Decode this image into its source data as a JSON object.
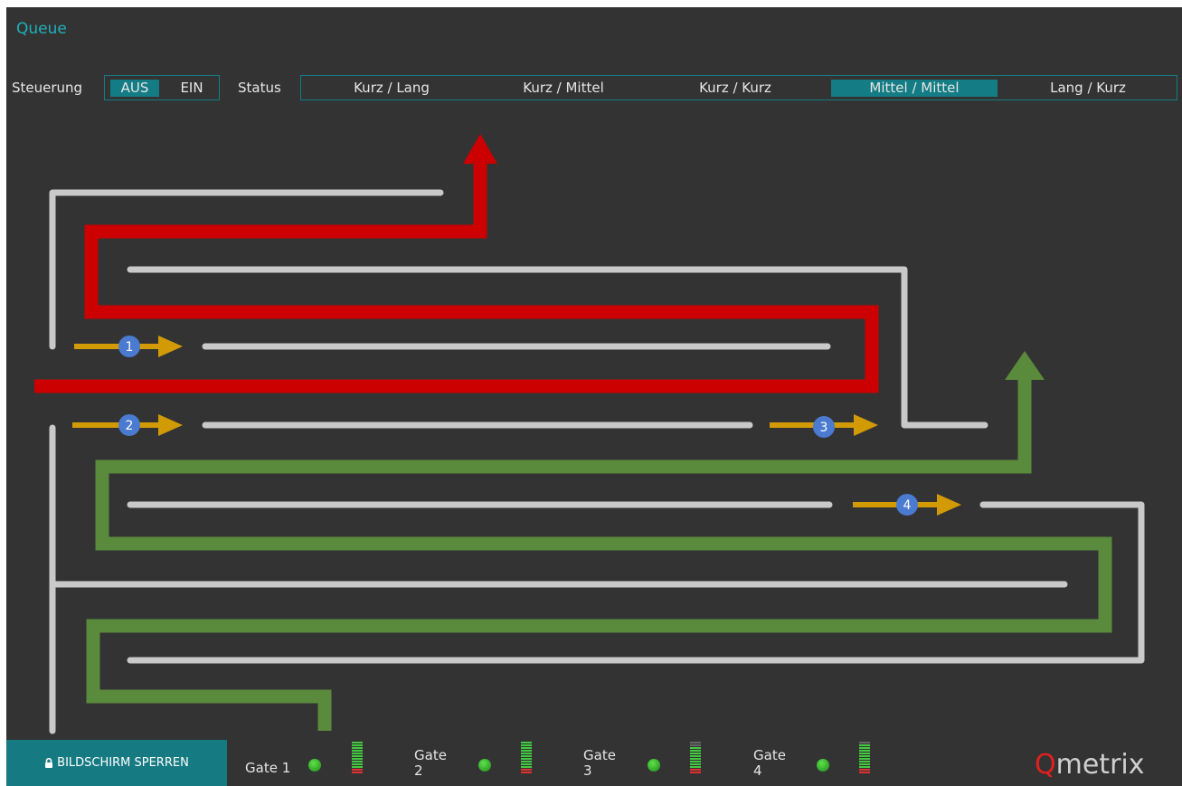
{
  "header": {
    "title": "Queue"
  },
  "controls": {
    "steuerung_label": "Steuerung",
    "toggle": {
      "off_label": "AUS",
      "on_label": "EIN",
      "selected": "AUS"
    },
    "status_label": "Status",
    "status_options": [
      "Kurz / Lang",
      "Kurz / Mittel",
      "Kurz / Kurz",
      "Mittel / Mittel",
      "Lang / Kurz"
    ],
    "status_selected": "Mittel / Mittel"
  },
  "map": {
    "entry_markers": [
      "1",
      "2",
      "3",
      "4"
    ],
    "colors": {
      "lane": "#c9c9c9",
      "red_path": "#cc0000",
      "green_path": "#5a8a3c",
      "arrow": "#d29b06",
      "marker": "#4a7bd0",
      "accent": "#147c84"
    }
  },
  "footer": {
    "lock_button_label": "BILDSCHIRM SPERREN",
    "lock_icon": "lock-icon",
    "gates": [
      {
        "label": "Gate 1",
        "led": "green",
        "level_bars": 10
      },
      {
        "label": "Gate 2",
        "led": "green",
        "level_bars": 10
      },
      {
        "label": "Gate 3",
        "led": "green",
        "level_bars": 8
      },
      {
        "label": "Gate 4",
        "led": "green",
        "level_bars": 10
      }
    ],
    "logo": {
      "q": "Q",
      "rest": "metrix"
    }
  }
}
